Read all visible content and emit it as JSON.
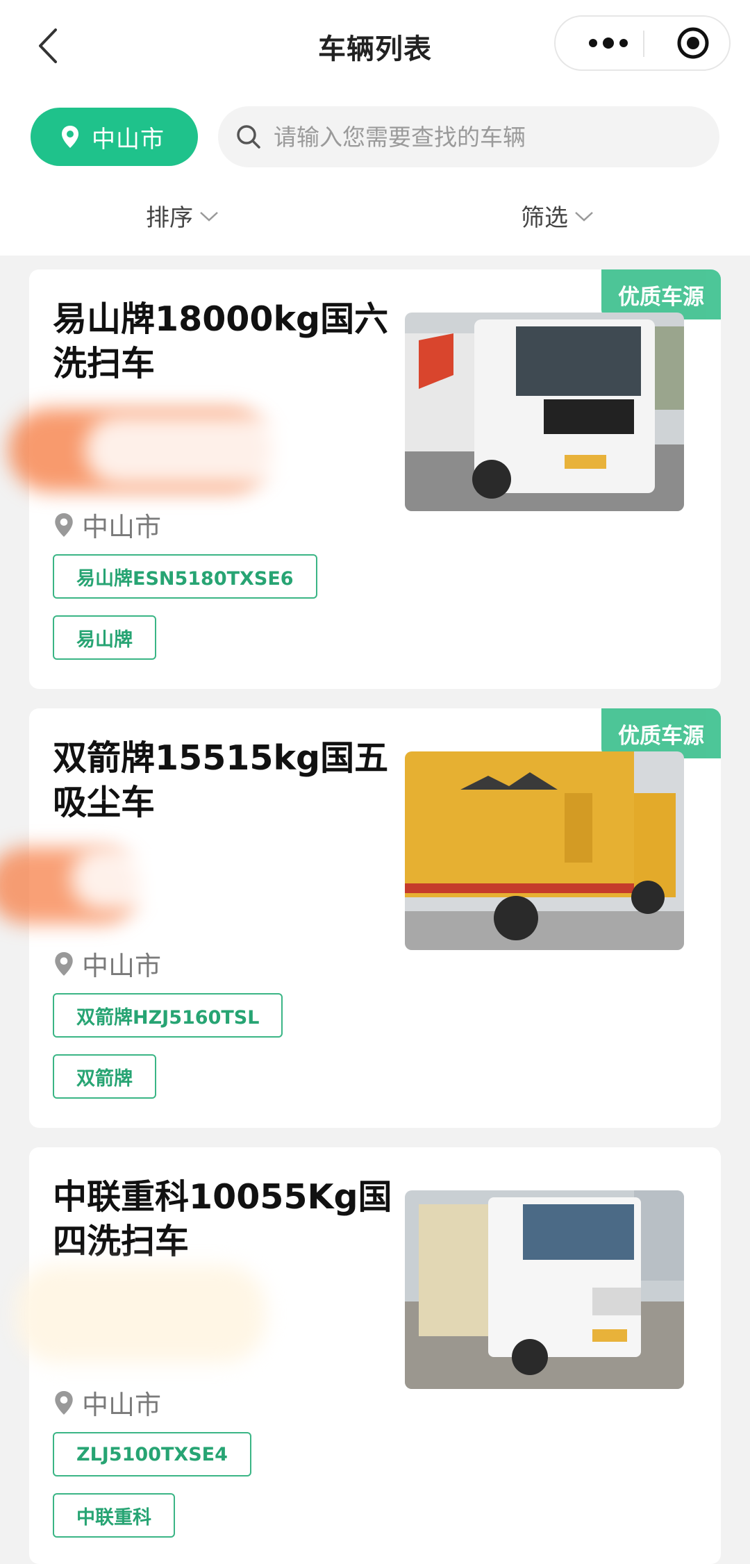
{
  "nav": {
    "title": "车辆列表"
  },
  "city": {
    "label": "中山市"
  },
  "search": {
    "placeholder": "请输入您需要查找的车辆"
  },
  "filters": {
    "sort_label": "排序",
    "filter_label": "筛选"
  },
  "vehicles": [
    {
      "badge": "优质车源",
      "title": "易山牌18000kg国六洗扫车",
      "location": "中山市",
      "tags": [
        "易山牌ESN5180TXSE6",
        "易山牌"
      ],
      "image_icon": "white-sweeper-truck-photo"
    },
    {
      "badge": "优质车源",
      "title": "双箭牌15515kg国五吸尘车",
      "location": "中山市",
      "tags": [
        "双箭牌HZJ5160TSL",
        "双箭牌"
      ],
      "image_icon": "yellow-dust-truck-photo"
    },
    {
      "badge": "",
      "title": "中联重科10055Kg国四洗扫车",
      "location": "中山市",
      "tags": [
        "ZLJ5100TXSE4",
        "中联重科"
      ],
      "image_icon": "white-isuzu-sweeper-photo"
    }
  ],
  "colors": {
    "accent": "#1fc28b",
    "tag_border": "#3ab585",
    "badge": "#3ec18f"
  }
}
